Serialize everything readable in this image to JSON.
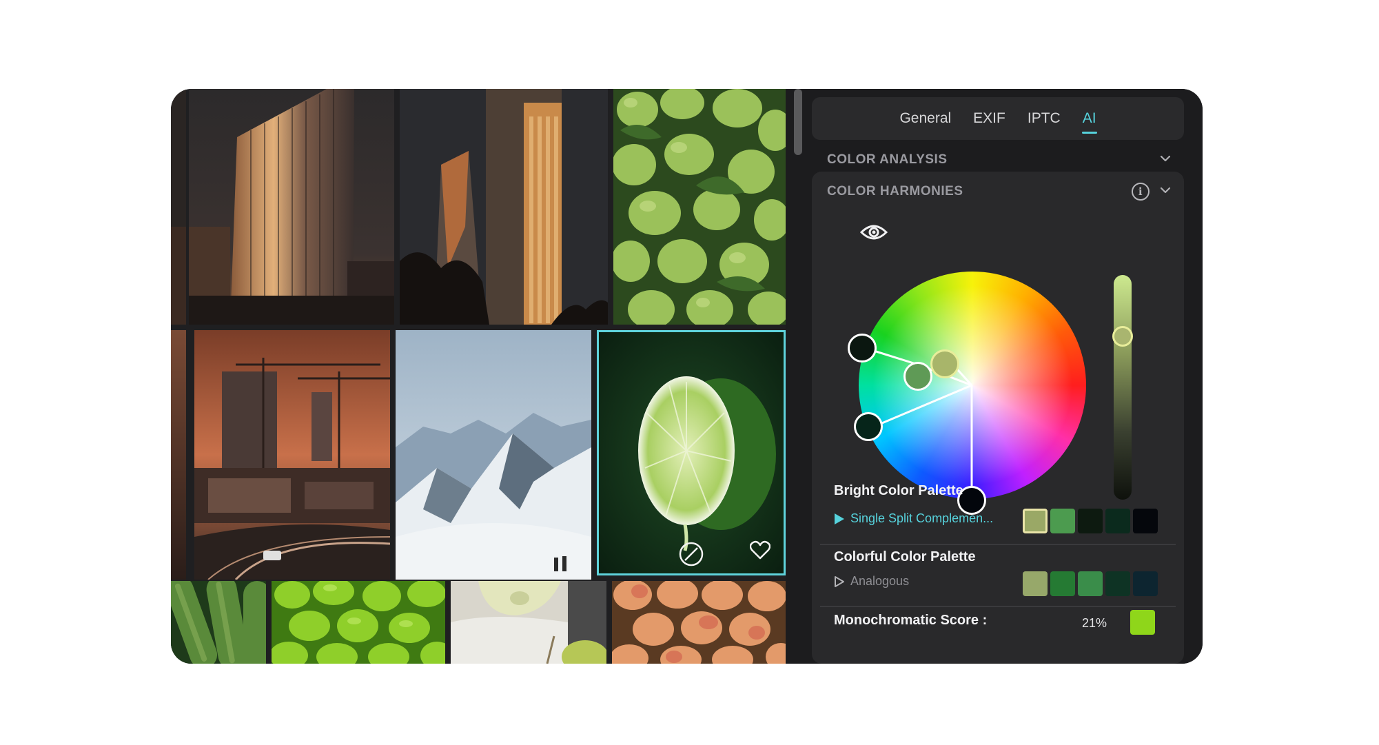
{
  "tabs": [
    {
      "label": "General",
      "active": false
    },
    {
      "label": "EXIF",
      "active": false
    },
    {
      "label": "IPTC",
      "active": false
    },
    {
      "label": "AI",
      "active": true
    }
  ],
  "sections": {
    "color_analysis": {
      "title": "COLOR ANALYSIS",
      "icon": "chevron-down-icon"
    },
    "color_harmonies": {
      "title": "COLOR HARMONIES",
      "icons": [
        "info-icon",
        "chevron-down-icon"
      ]
    }
  },
  "wheel": {
    "eye_icon": "eye-icon",
    "handle_colors": [
      "#0b1710",
      "#5f9a56",
      "#a8b56a",
      "#06251a",
      "#03060c"
    ],
    "brightness_slider": {
      "top_color": "#c9e98a",
      "bottom_color": "#151a12",
      "handle_color": "#a9b56f"
    }
  },
  "palettes": [
    {
      "title": "Bright Color Palette",
      "type_label": "Single Split Complemen...",
      "type_active": true,
      "type_icon": "play-filled-icon",
      "colors": [
        "#9aa866",
        "#4c9b4f",
        "#0d1a10",
        "#0b2a1d",
        "#05070c"
      ]
    },
    {
      "title": "Colorful Color Palette",
      "type_label": "Analogous",
      "type_active": false,
      "type_icon": "play-outline-icon",
      "colors": [
        "#97a86a",
        "#257a33",
        "#3a8d4a",
        "#0e3324",
        "#0d2530"
      ]
    }
  ],
  "monochromatic": {
    "label": "Monochromatic Score :",
    "value": "21%",
    "color": "#8fd61a"
  },
  "gallery": {
    "photos": [
      {
        "name": "photo-orange-skyscraper"
      },
      {
        "name": "photo-dark-towers"
      },
      {
        "name": "photo-limes-pile"
      },
      {
        "name": "photo-construction-cranes"
      },
      {
        "name": "photo-snowy-mountains"
      },
      {
        "name": "photo-lime-slice",
        "selected": true
      },
      {
        "name": "photo-cucumbers"
      },
      {
        "name": "photo-green-peppers"
      },
      {
        "name": "photo-pear"
      },
      {
        "name": "photo-peaches"
      }
    ],
    "selected_controls": [
      "dropper-icon",
      "heart-icon"
    ]
  },
  "accent_color": "#56d2dc"
}
